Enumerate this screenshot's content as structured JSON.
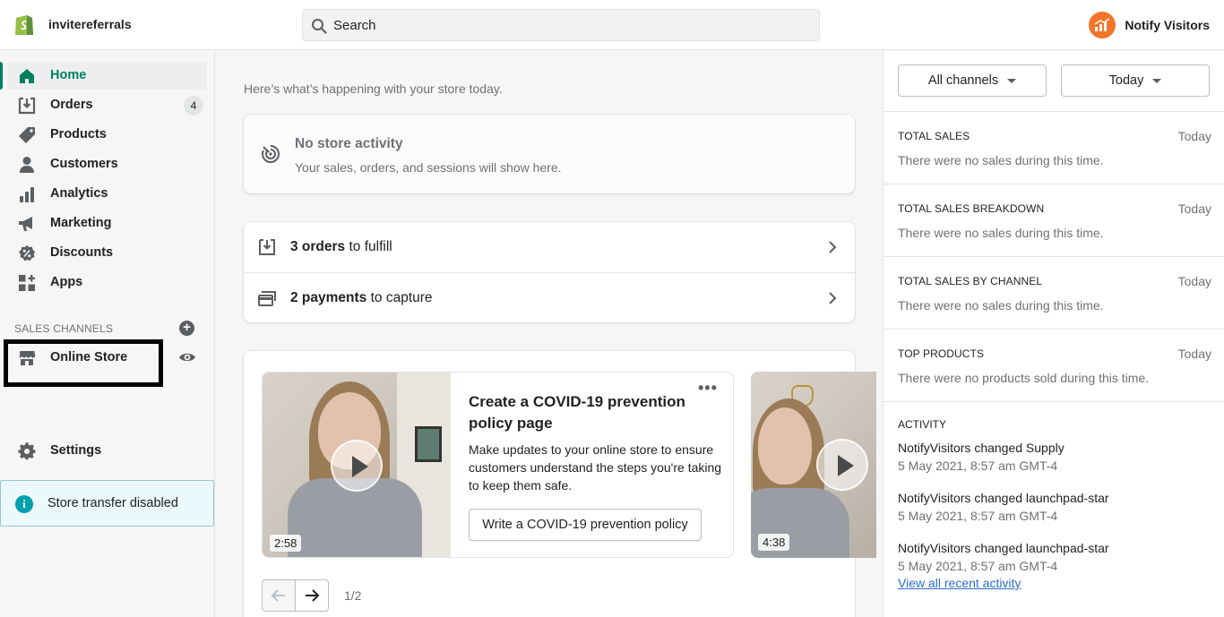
{
  "topbar": {
    "shop_name": "invitereferrals",
    "search_placeholder": "Search",
    "user_name": "Notify Visitors"
  },
  "sidebar": {
    "items": [
      {
        "label": "Home",
        "icon": "home-icon",
        "active": true
      },
      {
        "label": "Orders",
        "icon": "orders-icon",
        "badge": "4"
      },
      {
        "label": "Products",
        "icon": "tag-icon"
      },
      {
        "label": "Customers",
        "icon": "person-icon"
      },
      {
        "label": "Analytics",
        "icon": "bar-chart-icon"
      },
      {
        "label": "Marketing",
        "icon": "megaphone-icon"
      },
      {
        "label": "Discounts",
        "icon": "discount-icon"
      },
      {
        "label": "Apps",
        "icon": "apps-icon"
      }
    ],
    "sales_channels_label": "SALES CHANNELS",
    "online_store_label": "Online Store",
    "settings_label": "Settings",
    "transfer_label": "Store transfer disabled"
  },
  "main": {
    "intro": "Here’s what’s happening with your store today.",
    "no_activity_title": "No store activity",
    "no_activity_sub": "Your sales, orders, and sessions will show here.",
    "tasks": [
      {
        "bold": "3 orders",
        "rest": " to fulfill"
      },
      {
        "bold": "2 payments",
        "rest": " to capture"
      }
    ],
    "video": {
      "title": "Create a COVID-19 prevention policy page",
      "description": "Make updates to your online store to ensure customers understand the steps you're taking to keep them safe.",
      "button": "Write a COVID-19 prevention policy",
      "duration_1": "2:58",
      "duration_2": "4:38",
      "more_label": "•••",
      "pager": "1/2"
    }
  },
  "right": {
    "channels_filter": "All channels",
    "date_filter": "Today",
    "stats": [
      {
        "title": "TOTAL SALES",
        "period": "Today",
        "message": "There were no sales during this time."
      },
      {
        "title": "TOTAL SALES BREAKDOWN",
        "period": "Today",
        "message": "There were no sales during this time."
      },
      {
        "title": "TOTAL SALES BY CHANNEL",
        "period": "Today",
        "message": "There were no sales during this time."
      },
      {
        "title": "TOP PRODUCTS",
        "period": "Today",
        "message": "There were no products sold during this time."
      }
    ],
    "activity_title": "ACTIVITY",
    "activity": [
      {
        "text": "NotifyVisitors changed Supply",
        "time": "5 May 2021, 8:57 am GMT-4"
      },
      {
        "text": "NotifyVisitors changed launchpad-star",
        "time": "5 May 2021, 8:57 am GMT-4"
      },
      {
        "text": "NotifyVisitors changed launchpad-star",
        "time": "5 May 2021, 8:57 am GMT-4"
      }
    ],
    "view_all": "View all recent activity"
  },
  "colors": {
    "accent_green": "#008060",
    "link_blue": "#2c6ecb",
    "avatar_orange": "#f4752a",
    "info_teal": "#00a0ac"
  }
}
